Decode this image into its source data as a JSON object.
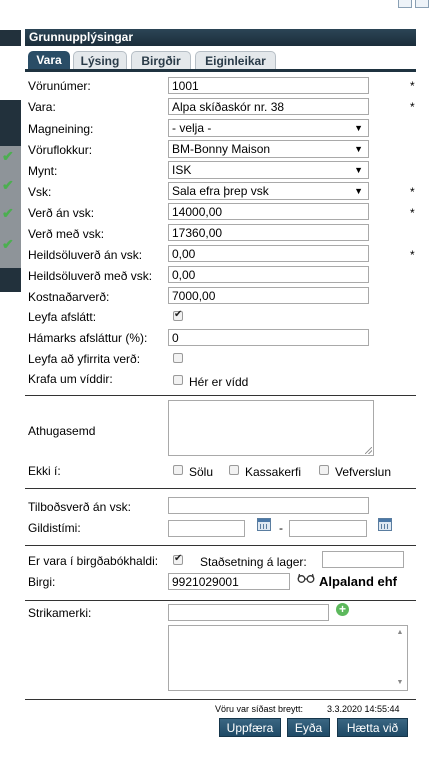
{
  "header": {
    "title": "Grunnupplýsingar"
  },
  "tabs": [
    {
      "label": "Vara"
    },
    {
      "label": "Lýsing"
    },
    {
      "label": "Birgðir"
    },
    {
      "label": "Eiginleikar"
    }
  ],
  "form": {
    "vorunumer": {
      "label": "Vörunúmer:",
      "value": "1001",
      "required": "*"
    },
    "vara": {
      "label": "Vara:",
      "value": "Alpa skíðaskór nr. 38",
      "required": "*"
    },
    "magneining": {
      "label": "Magneining:",
      "value": "- velja -"
    },
    "voruflokkur": {
      "label": "Vöruflokkur:",
      "value": "BM-Bonny Maison"
    },
    "mynt": {
      "label": "Mynt:",
      "value": "ISK"
    },
    "vsk": {
      "label": "Vsk:",
      "value": "Sala efra þrep vsk",
      "required": "*"
    },
    "verd_an_vsk": {
      "label": "Verð án vsk:",
      "value": "14000,00",
      "required": "*"
    },
    "verd_med_vsk": {
      "label": "Verð með vsk:",
      "value": "17360,00"
    },
    "heildsoluverd_an_vsk": {
      "label": "Heildsöluverð án vsk:",
      "value": "0,00",
      "required": "*"
    },
    "heildsoluverd_med_vsk": {
      "label": "Heildsöluverð með vsk:",
      "value": "0,00"
    },
    "kostnadarverd": {
      "label": "Kostnaðarverð:",
      "value": "7000,00"
    },
    "leyfa_afslatt": {
      "label": "Leyfa afslátt:",
      "checked": true
    },
    "hamarks_afslattur": {
      "label": "Hámarks afsláttur (%):",
      "value": "0"
    },
    "leyfa_yfirrita": {
      "label": "Leyfa að yfirrita verð:",
      "checked": false
    },
    "krafa_um_viddir": {
      "label": "Krafa um víddir:",
      "option": "Hér er vídd",
      "checked": false
    },
    "athugasemd": {
      "label": "Athugasemd"
    },
    "ekki_i": {
      "label": "Ekki í:",
      "options": [
        "Sölu",
        "Kassakerfi",
        "Vefverslun"
      ]
    },
    "tilbodsverd": {
      "label": "Tilboðsverð án vsk:",
      "value": ""
    },
    "gildistimi": {
      "label": "Gildistími:",
      "separator": "-"
    },
    "birgdabokhald": {
      "label": "Er vara í birgðabókhaldi:",
      "checked": true
    },
    "stadsetning": {
      "label": "Staðsetning á lager:",
      "value": ""
    },
    "birgi": {
      "label": "Birgi:",
      "value": "9921029001",
      "name": "Alpaland ehf"
    },
    "strikamerki": {
      "label": "Strikamerki:",
      "value": ""
    }
  },
  "footer": {
    "last_changed_label": "Vöru var síðast breytt:",
    "last_changed_value": "3.3.2020 14:55:44",
    "buttons": {
      "update": "Uppfæra",
      "delete": "Eyða",
      "cancel": "Hætta við"
    }
  },
  "icons": [
    "check-icon",
    "calendar-icon",
    "glasses-icon",
    "plus-icon",
    "chevron-down-icon"
  ],
  "colors": {
    "header": "#1f3340",
    "tab_active": "#2a4d66",
    "button": "#2a5573",
    "check": "#4caf50",
    "plus": "#5cb85c"
  }
}
